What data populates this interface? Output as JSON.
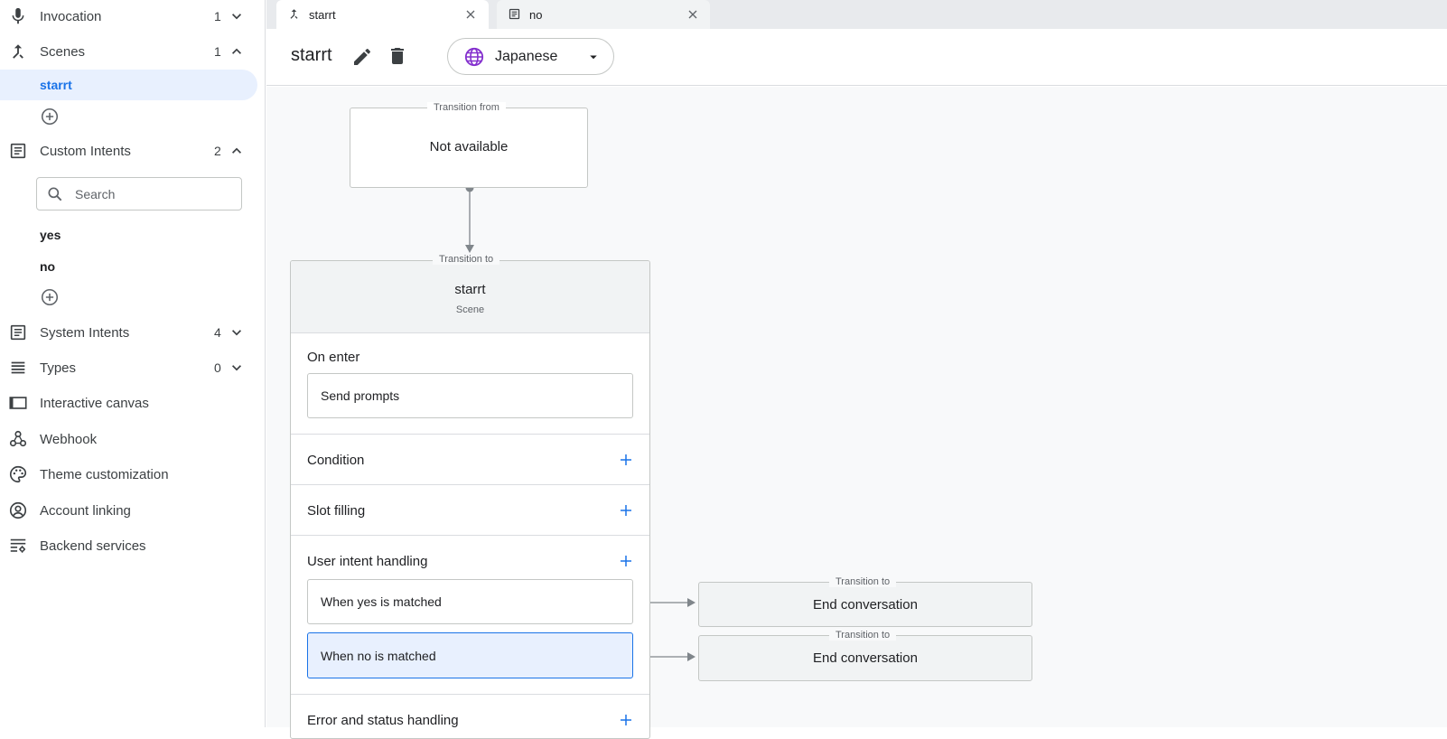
{
  "sidebar": {
    "invocation": {
      "label": "Invocation",
      "count": "1"
    },
    "scenes": {
      "label": "Scenes",
      "count": "1",
      "items": [
        {
          "label": "starrt"
        }
      ]
    },
    "custom_intents": {
      "label": "Custom Intents",
      "count": "2",
      "search": {
        "placeholder": "Search"
      },
      "items": [
        {
          "label": "yes"
        },
        {
          "label": "no"
        }
      ]
    },
    "system_intents": {
      "label": "System Intents",
      "count": "4"
    },
    "types": {
      "label": "Types",
      "count": "0"
    },
    "interactive_canvas": {
      "label": "Interactive canvas"
    },
    "webhook": {
      "label": "Webhook"
    },
    "theme_customization": {
      "label": "Theme customization"
    },
    "account_linking": {
      "label": "Account linking"
    },
    "backend_services": {
      "label": "Backend services"
    }
  },
  "tabs": [
    {
      "label": "starrt",
      "icon": "scene-icon",
      "active": true
    },
    {
      "label": "no",
      "icon": "intent-icon",
      "active": false
    }
  ],
  "header": {
    "title": "starrt",
    "language": {
      "label": "Japanese",
      "icon": "globe-icon"
    }
  },
  "canvas": {
    "transition_from": {
      "label": "Transition from",
      "value": "Not available"
    },
    "scene": {
      "transition_label": "Transition to",
      "name": "starrt",
      "kind": "Scene"
    },
    "sections": {
      "on_enter": {
        "title": "On enter",
        "items": [
          "Send prompts"
        ]
      },
      "condition": {
        "title": "Condition"
      },
      "slot_filling": {
        "title": "Slot filling"
      },
      "user_intent_handling": {
        "title": "User intent handling",
        "items": [
          {
            "label": "When yes is matched",
            "target_label": "Transition to",
            "target": "End conversation"
          },
          {
            "label": "When no is matched",
            "target_label": "Transition to",
            "target": "End conversation"
          }
        ]
      },
      "error_status": {
        "title": "Error and status handling"
      }
    }
  },
  "colors": {
    "accent": "#1a73e8",
    "selected_bg": "#e8f0fe",
    "globe": "#8430ce",
    "canvas_bg": "#f8f9fa",
    "connector": "#80868b"
  }
}
